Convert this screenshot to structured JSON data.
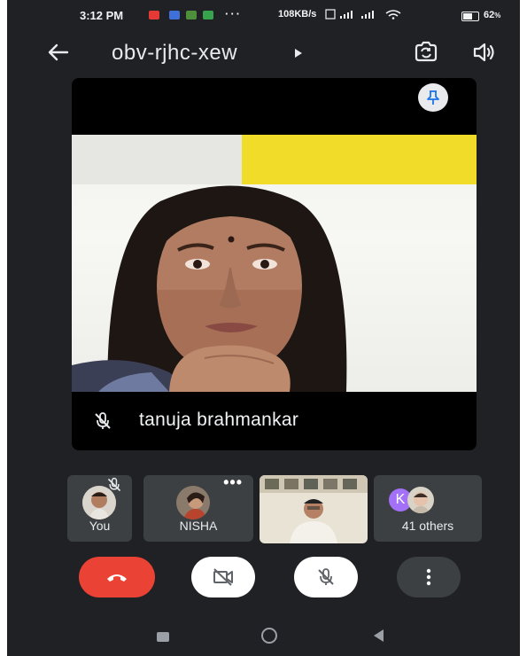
{
  "status_bar": {
    "time": "3:12 PM",
    "dots": "···",
    "network": "108KB/s",
    "battery": "62"
  },
  "header": {
    "back_icon": "arrow-back-icon",
    "meeting_code": "obv-rjhc-xew",
    "camera_switch_icon": "camera-switch-icon",
    "audio_icon": "speaker-icon"
  },
  "main_tile": {
    "participant_name": "tanuja brahmankar",
    "pin_icon": "pin-icon",
    "mic_state_icon": "mic-off-icon"
  },
  "participants": [
    {
      "label": "You",
      "muted": true
    },
    {
      "label": "NISHA",
      "more": "•••"
    },
    {
      "label": ""
    },
    {
      "label": "41 others",
      "initial": "K"
    }
  ],
  "controls": {
    "end_call_icon": "phone-hangup-icon",
    "camera_icon": "camera-off-icon",
    "mic_icon": "mic-off-icon",
    "more_icon": "more-vert-icon"
  },
  "colors": {
    "background": "#202124",
    "end_call": "#ea4335",
    "tile": "#3c4043",
    "k_avatar": "#a371f7",
    "wall_yellow": "#f1dc2a"
  }
}
